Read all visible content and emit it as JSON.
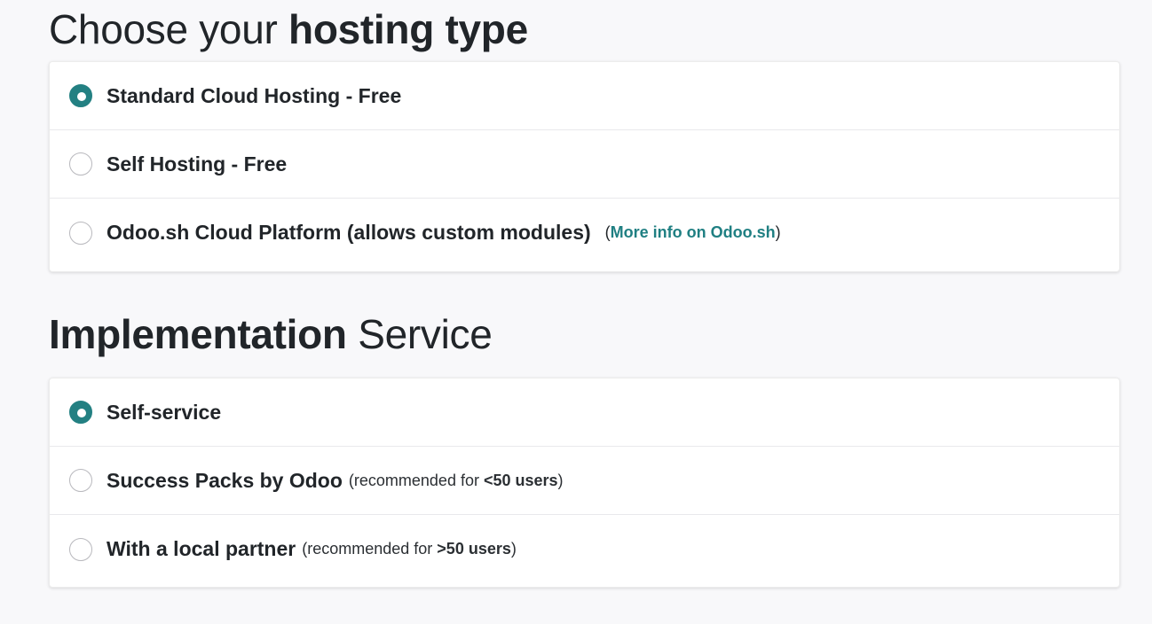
{
  "hosting": {
    "title_light": "Choose your",
    "title_bold": "hosting type",
    "options": [
      {
        "label": "Standard Cloud Hosting - Free",
        "selected": true
      },
      {
        "label": "Self Hosting - Free",
        "selected": false
      },
      {
        "label": "Odoo.sh Cloud Platform (allows custom modules)",
        "selected": false,
        "link_open": "(",
        "link_text": "More info on Odoo.sh",
        "link_close": ")"
      }
    ]
  },
  "implementation": {
    "title_bold": "Implementation",
    "title_light": "Service",
    "options": [
      {
        "label": "Self-service",
        "selected": true
      },
      {
        "label": "Success Packs by Odoo",
        "selected": false,
        "note_prefix": "(recommended for ",
        "note_bold": "<50 users",
        "note_suffix": ")"
      },
      {
        "label": "With a local partner",
        "selected": false,
        "note_prefix": "(recommended for ",
        "note_bold": ">50 users",
        "note_suffix": ")"
      }
    ]
  },
  "colors": {
    "accent": "#238082",
    "link": "#1f7f82",
    "background": "#f8f8fa"
  }
}
